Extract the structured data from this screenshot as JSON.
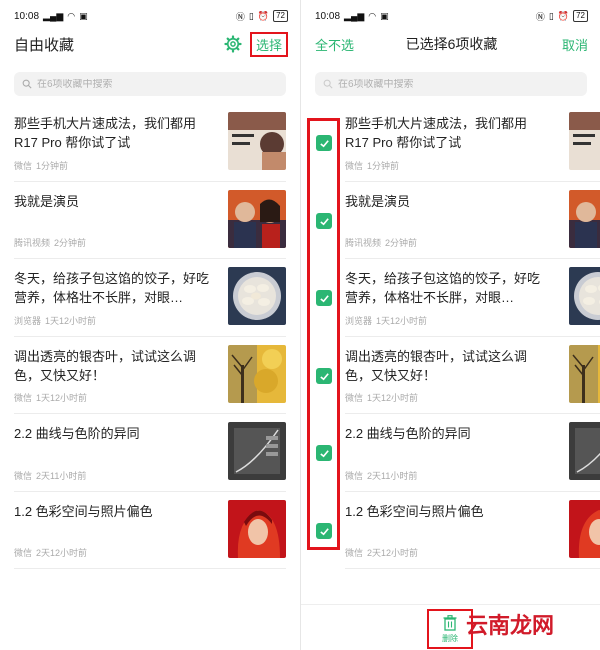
{
  "status_bar": {
    "time": "10:08",
    "battery": "72"
  },
  "left_screen": {
    "title": "自由收藏",
    "select_label": "选择",
    "search_placeholder": "在6项收藏中搜索"
  },
  "right_screen": {
    "deselect_all_label": "全不选",
    "selected_title": "已选择6项收藏",
    "cancel_label": "取消",
    "search_placeholder": "在6项收藏中搜索",
    "delete_label": "删除"
  },
  "items": [
    {
      "title": "那些手机大片速成法，我们都用R17 Pro 帮你试了试",
      "source": "微信",
      "time": "1分钟前",
      "thumb": "thumb-camera-review"
    },
    {
      "title": "我就是演员",
      "source": "腾讯视频",
      "time": "2分钟前",
      "thumb": "thumb-actors"
    },
    {
      "title": "冬天，给孩子包这馅的饺子，好吃营养，体格壮不长胖，对眼…",
      "source": "浏览器",
      "time": "1天12小时前",
      "thumb": "thumb-dumplings"
    },
    {
      "title": "调出透亮的银杏叶，试试这么调色，又快又好！",
      "source": "微信",
      "time": "1天12小时前",
      "thumb": "thumb-ginkgo"
    },
    {
      "title": "2.2 曲线与色阶的异同",
      "source": "微信",
      "time": "2天11小时前",
      "thumb": "thumb-curves"
    },
    {
      "title": "1.2  色彩空间与照片偏色",
      "source": "微信",
      "time": "2天12小时前",
      "thumb": "thumb-color-space"
    }
  ],
  "watermark": "云南龙网",
  "colors": {
    "accent": "#2bb673",
    "highlight": "#e3141c"
  }
}
